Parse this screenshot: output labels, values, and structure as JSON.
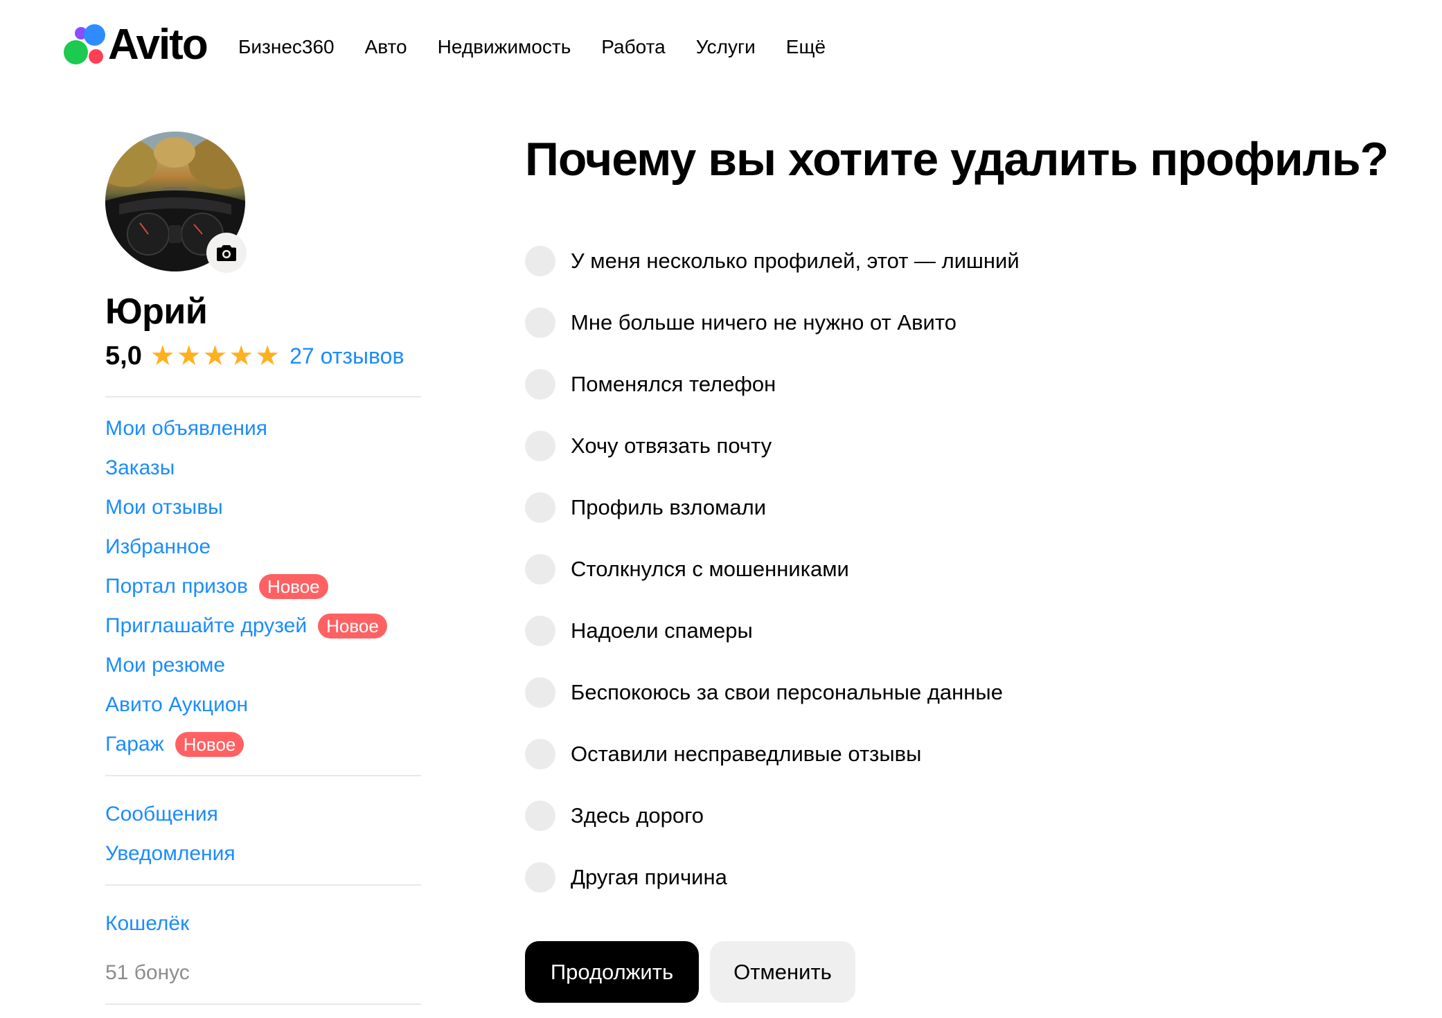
{
  "header": {
    "logo_text": "Avito",
    "nav": [
      {
        "label": "Бизнес360"
      },
      {
        "label": "Авто"
      },
      {
        "label": "Недвижимость"
      },
      {
        "label": "Работа"
      },
      {
        "label": "Услуги"
      },
      {
        "label": "Ещё"
      }
    ]
  },
  "profile": {
    "name": "Юрий",
    "rating": "5,0",
    "stars": 5,
    "reviews_link": "27 отзывов"
  },
  "sidebar": {
    "menu_primary": [
      {
        "label": "Мои объявления",
        "badge": ""
      },
      {
        "label": "Заказы",
        "badge": ""
      },
      {
        "label": "Мои отзывы",
        "badge": ""
      },
      {
        "label": "Избранное",
        "badge": ""
      },
      {
        "label": "Портал призов",
        "badge": "Новое"
      },
      {
        "label": "Приглашайте друзей",
        "badge": "Новое"
      },
      {
        "label": "Мои резюме",
        "badge": ""
      },
      {
        "label": "Авито Аукцион",
        "badge": ""
      },
      {
        "label": "Гараж",
        "badge": "Новое"
      }
    ],
    "menu_secondary": [
      {
        "label": "Сообщения"
      },
      {
        "label": "Уведомления"
      }
    ],
    "wallet": {
      "label": "Кошелёк",
      "bonus": "51 бонус"
    }
  },
  "main": {
    "title": "Почему вы хотите удалить профиль?",
    "options": [
      "У меня несколько профилей, этот — лишний",
      "Мне больше ничего не нужно от Авито",
      "Поменялся телефон",
      "Хочу отвязать почту",
      "Профиль взломали",
      "Столкнулся с мошенниками",
      "Надоели спамеры",
      "Беспокоюсь за свои персональные данные",
      "Оставили несправедливые отзывы",
      "Здесь дорого",
      "Другая причина"
    ],
    "continue_label": "Продолжить",
    "cancel_label": "Отменить"
  },
  "colors": {
    "link": "#1a8cff",
    "badge": "#ff6163",
    "star": "#ffb021",
    "primary_button": "#000000",
    "radio": "#ebebeb"
  }
}
